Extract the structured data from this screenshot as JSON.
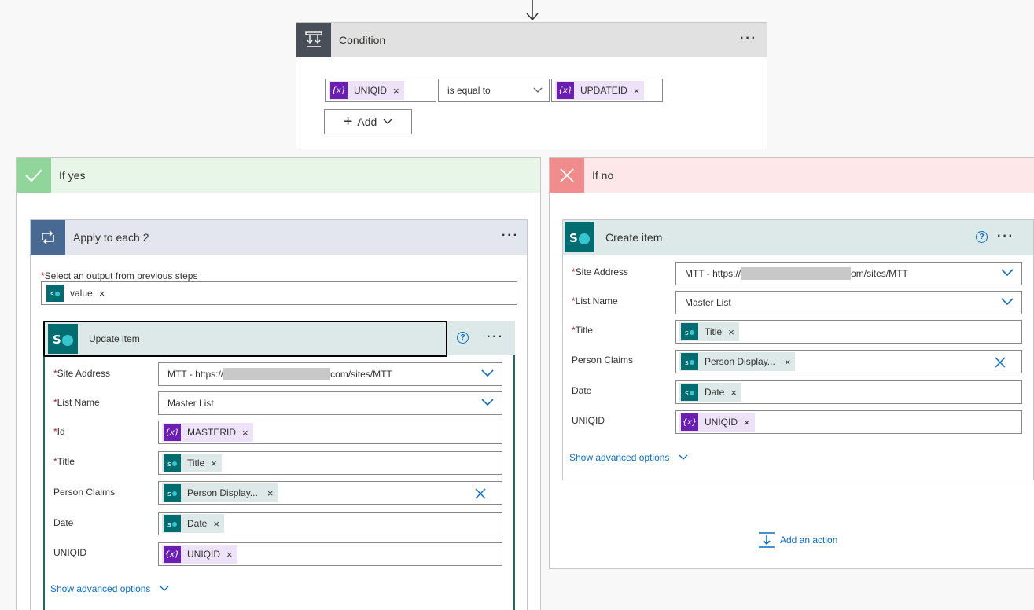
{
  "condition": {
    "title": "Condition",
    "left_token": "UNIQID",
    "operator": "is equal to",
    "right_token": "UPDATEID",
    "add_label": "Add"
  },
  "if_yes": {
    "label": "If yes"
  },
  "if_no": {
    "label": "If no"
  },
  "apply_each": {
    "title": "Apply to each 2",
    "select_label": "Select an output from previous steps",
    "select_token": "value"
  },
  "update_item": {
    "title": "Update item",
    "site_label": "Site Address",
    "site_value_prefix": "MTT - https://",
    "site_value_suffix": "com/sites/MTT",
    "list_label": "List Name",
    "list_value": "Master List",
    "id_label": "Id",
    "id_token": "MASTERID",
    "title_label": "Title",
    "title_token": "Title",
    "person_label": "Person Claims",
    "person_token": "Person Display...",
    "date_label": "Date",
    "date_token": "Date",
    "uniq_label": "UNIQID",
    "uniq_token": "UNIQID",
    "advanced": "Show advanced options"
  },
  "create_item": {
    "title": "Create item",
    "site_label": "Site Address",
    "site_value_prefix": "MTT - https://",
    "site_value_suffix": "om/sites/MTT",
    "list_label": "List Name",
    "list_value": "Master List",
    "title_label": "Title",
    "title_token": "Title",
    "person_label": "Person Claims",
    "person_token": "Person Display...",
    "date_label": "Date",
    "date_token": "Date",
    "uniq_label": "UNIQID",
    "uniq_token": "UNIQID",
    "advanced": "Show advanced options"
  },
  "add_action": "Add an action",
  "colors": {
    "accent": "#0f6cbd",
    "sharepoint": "#036c70",
    "expression": "#6b1fb1",
    "yes_bg": "#e8f6e8",
    "no_bg": "#fde7e9"
  }
}
